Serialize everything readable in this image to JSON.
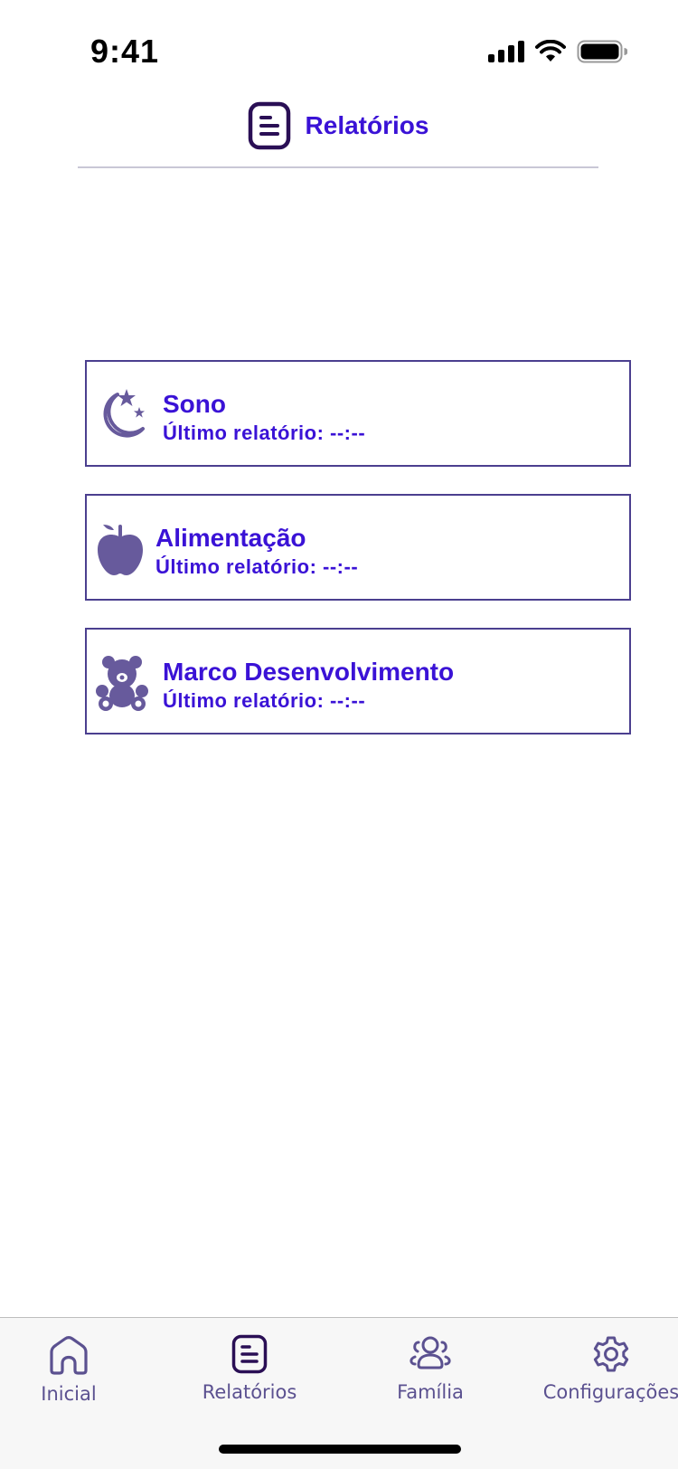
{
  "status_bar": {
    "time": "9:41"
  },
  "header": {
    "title": "Relatórios",
    "icon": "report-icon"
  },
  "reports": [
    {
      "title": "Sono",
      "subtitle": "Último relatório: --:--",
      "icon": "moon-stars-icon"
    },
    {
      "title": "Alimentação",
      "subtitle": "Último relatório: --:--",
      "icon": "apple-icon"
    },
    {
      "title": "Marco Desenvolvimento",
      "subtitle": "Último relatório: --:--",
      "icon": "teddy-bear-icon"
    }
  ],
  "tab_bar": {
    "tabs": [
      {
        "label": "Inicial",
        "icon": "home-icon"
      },
      {
        "label": "Relatórios",
        "icon": "report-icon",
        "active": true
      },
      {
        "label": "Família",
        "icon": "family-icon"
      },
      {
        "label": "Configurações",
        "icon": "gear-icon"
      }
    ]
  },
  "colors": {
    "accent": "#3a12d6",
    "icon": "#675a9c",
    "border": "#4b3f8f",
    "tab_label": "#5b5190"
  }
}
